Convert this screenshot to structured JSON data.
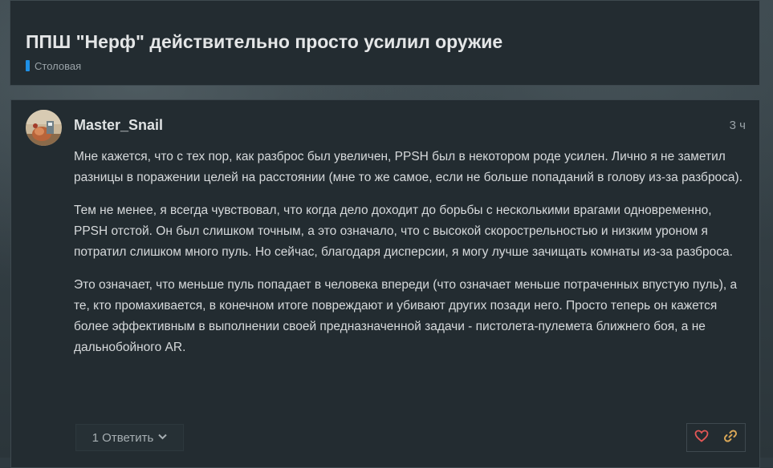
{
  "topic": {
    "title": "ППШ \"Нерф\" действительно просто усилил оружие",
    "category": "Столовая",
    "category_color": "#1e90e6"
  },
  "post": {
    "username": "Master_Snail",
    "time": "3 ч",
    "avatar_icon": "avatar-image",
    "paragraphs": [
      "Мне кажется, что с тех пор, как разброс был увеличен, PPSH был в некотором роде усилен. Лично я не заметил разницы в поражении целей на расстоянии (мне то же самое, если не больше попаданий в голову из-за разброса).",
      "Тем не менее, я всегда чувствовал, что когда дело доходит до борьбы с несколькими врагами одновременно, PPSH отстой. Он был слишком точным, а это означало, что с высокой скорострельностью и низким уроном я потратил слишком много пуль. Но сейчас, благодаря дисперсии, я могу лучше зачищать комнаты из-за разброса.",
      "Это означает, что меньше пуль попадает в человека впереди (что означает меньше потраченных впустую пуль), а те, кто промахивается, в конечном итоге повреждают и убивают других позади него. Просто теперь он кажется более эффективным в выполнении своей предназначенной задачи - пистолета-пулемета ближнего боя, а не дальнобойного AR."
    ],
    "reply_label": "1 Ответить",
    "like_icon": "heart-icon",
    "link_icon": "link-icon",
    "like_color": "#e45756",
    "link_color": "#d8a657"
  }
}
